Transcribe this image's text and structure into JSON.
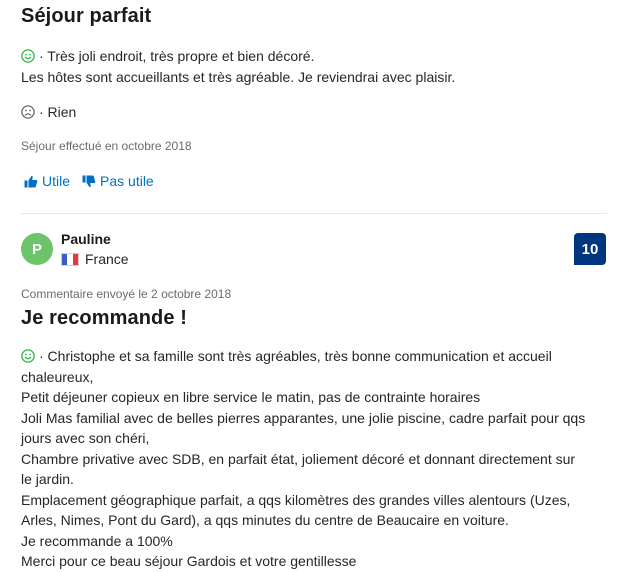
{
  "review1": {
    "title": "Séjour parfait",
    "positive": "· Très joli endroit, très propre et bien décoré.",
    "positive_line2": "Les hôtes sont accueillants et très agréable. Je reviendrai avec plaisir.",
    "negative": "· Rien",
    "stay": "Séjour effectué en octobre 2018",
    "helpful": "Utile",
    "not_helpful": "Pas utile"
  },
  "review2": {
    "avatar_letter": "P",
    "name": "Pauline",
    "country": "France",
    "score": "10",
    "submitted": "Commentaire envoyé le 2 octobre 2018",
    "title": "Je recommande !",
    "lines": [
      "· Christophe et sa famille sont très agréables, très bonne communication et accueil",
      "chaleureux,",
      "Petit déjeuner copieux en libre service le matin, pas de contrainte horaires",
      "Joli Mas familial avec de belles pierres apparantes, une jolie piscine, cadre parfait pour qqs",
      "jours avec son chéri,",
      "Chambre privative avec SDB, en parfait état, joliement décoré et donnant directement sur",
      "le jardin.",
      "Emplacement géographique parfait, a qqs kilomètres des grandes villes alentours (Uzes,",
      "Arles, Nimes, Pont du Gard), a qqs minutes du centre de Beaucaire en voiture.",
      "Je recommande a 100%",
      "Merci pour ce beau séjour Gardois et votre gentillesse"
    ]
  },
  "icons": {
    "positive": "smiley-face-icon",
    "negative": "sad-face-icon",
    "helpful": "thumbs-up-icon",
    "not_helpful": "thumbs-down-icon",
    "flag": "france-flag-icon"
  },
  "colors": {
    "positive": "#2db742",
    "link": "#0071c2",
    "score_bg": "#003580",
    "avatar_bg": "#6cc36a"
  }
}
